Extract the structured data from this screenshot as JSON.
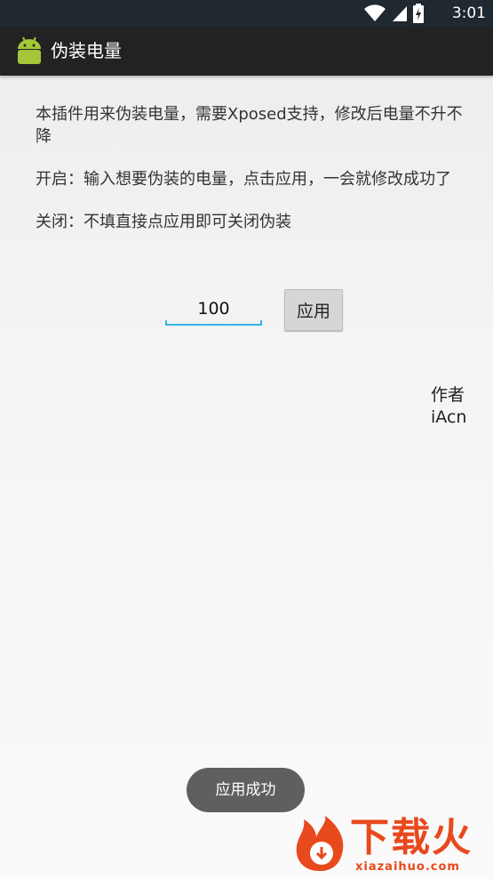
{
  "status_bar": {
    "time": "3:01",
    "icons": [
      "wifi-icon",
      "signal-icon",
      "battery-charging-icon"
    ]
  },
  "action_bar": {
    "app_icon": "android-robot-icon",
    "title": "伪装电量"
  },
  "content": {
    "paragraph_1": "本插件用来伪装电量，需要Xposed支持，修改后电量不升不降",
    "paragraph_2": "开启：输入想要伪装的电量，点击应用，一会就修改成功了",
    "paragraph_3": "关闭：不填直接点应用即可关闭伪装"
  },
  "form": {
    "battery_value": "100",
    "apply_label": "应用"
  },
  "author": {
    "label": "作者",
    "name": "iAcn"
  },
  "toast": {
    "message": "应用成功"
  },
  "watermark": {
    "brand": "下载火",
    "url": "xiazaihuo.com"
  },
  "colors": {
    "accent": "#33b5e5",
    "action_bar": "#222222",
    "status_bar": "#202830",
    "android_green": "#a4c639",
    "watermark": "#e8491d"
  }
}
